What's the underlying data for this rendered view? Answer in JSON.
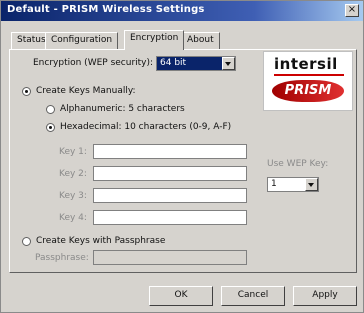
{
  "window": {
    "title": "Default - PRISM Wireless Settings",
    "close_glyph": "×"
  },
  "tabs": [
    {
      "label": "Status"
    },
    {
      "label": "Configuration"
    },
    {
      "label": "Encryption"
    },
    {
      "label": "About"
    }
  ],
  "encryption": {
    "wep_label": "Encryption (WEP security):",
    "wep_value": "64 bit",
    "create_keys_manually": "Create Keys Manually:",
    "alphanumeric": "Alphanumeric: 5 characters",
    "hexadecimal": "Hexadecimal: 10 characters (0-9, A-F)",
    "keys": [
      {
        "label": "Key 1:",
        "value": ""
      },
      {
        "label": "Key 2:",
        "value": ""
      },
      {
        "label": "Key 3:",
        "value": ""
      },
      {
        "label": "Key 4:",
        "value": ""
      }
    ],
    "use_wep_key_label": "Use WEP Key:",
    "use_wep_key_value": "1",
    "create_with_passphrase": "Create Keys with Passphrase",
    "passphrase_label": "Passphrase:",
    "passphrase_value": ""
  },
  "logo": {
    "brand": "intersil",
    "product": "PRISM"
  },
  "buttons": {
    "ok": "OK",
    "cancel": "Cancel",
    "apply": "Apply"
  }
}
